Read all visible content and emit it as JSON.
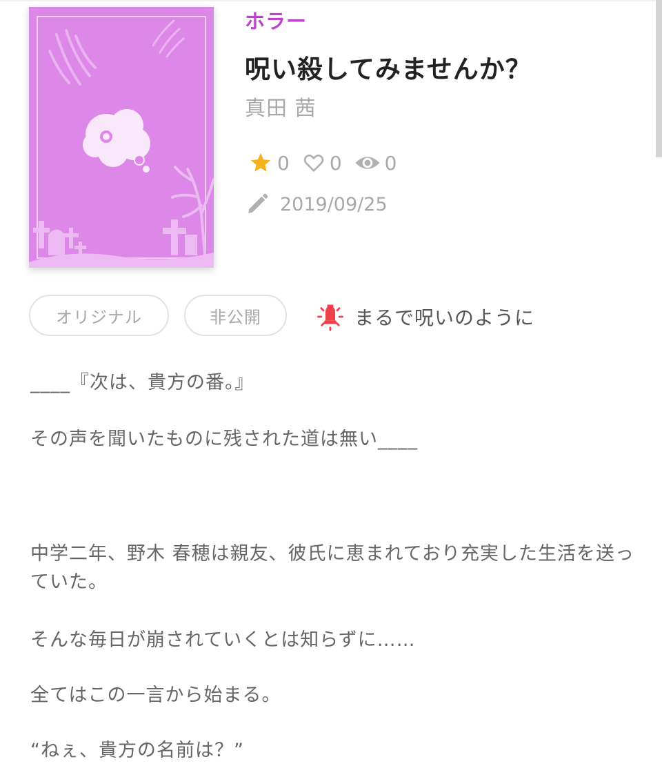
{
  "colors": {
    "genre": "#c040d0",
    "cover_bg": "#dd88e8",
    "star": "#f6b21a",
    "bulb": "#ef3f4a",
    "muted_text": "#a8a8a8",
    "body_text": "#666666"
  },
  "work": {
    "genre": "ホラー",
    "title": "呪い殺してみませんか？",
    "author": "真田 茜",
    "stats": {
      "stars": "0",
      "likes": "0",
      "views": "0"
    },
    "updated": "2019/09/25"
  },
  "tags": {
    "original": "オリジナル",
    "private": "非公開"
  },
  "catchphrase": "まるで呪いのように",
  "icons": {
    "star": "star-icon",
    "like": "heart-icon",
    "view": "eye-icon",
    "date": "pencil-icon",
    "catch": "lightbulb-icon"
  },
  "story": {
    "p1": "____『次は、貴方の番。』",
    "p2": "その声を聞いたものに残された道は無い____",
    "p3": "中学二年、野木 春穂は親友、彼氏に恵まれており充実した生活を送っていた。",
    "p4": "そんな毎日が崩されていくとは知らずに……",
    "p5": "全てはこの一言から始まる。",
    "p6": "“ねぇ、貴方の名前は？”"
  }
}
